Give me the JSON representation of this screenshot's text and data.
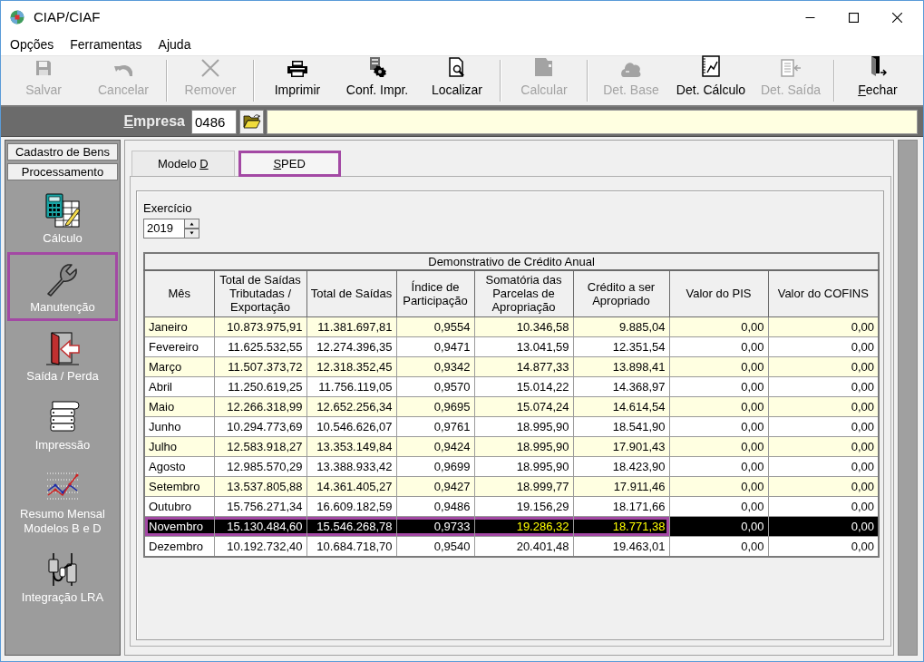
{
  "window": {
    "title": "CIAP/CIAF"
  },
  "menu": [
    "Opções",
    "Ferramentas",
    "Ajuda"
  ],
  "toolbar": {
    "groups": [
      {
        "buttons": [
          {
            "label": "Salvar",
            "kind": "save",
            "disabled": true
          },
          {
            "label": "Cancelar",
            "kind": "cancel",
            "disabled": true
          }
        ]
      },
      {
        "buttons": [
          {
            "label": "Remover",
            "kind": "remove",
            "disabled": true
          }
        ]
      },
      {
        "buttons": [
          {
            "label": "Imprimir",
            "kind": "print",
            "disabled": false
          },
          {
            "label": "Conf. Impr.",
            "kind": "print-setup",
            "disabled": false
          },
          {
            "label": "Localizar",
            "kind": "find",
            "disabled": false
          }
        ]
      },
      {
        "buttons": [
          {
            "label": "Calcular",
            "kind": "calculate",
            "disabled": true
          }
        ]
      },
      {
        "buttons": [
          {
            "label": "Det. Base",
            "kind": "base-detail",
            "disabled": true
          },
          {
            "label": "Det. Cálculo",
            "kind": "calc-detail",
            "disabled": false
          },
          {
            "label": "Det. Saída",
            "kind": "exit-detail",
            "disabled": true
          }
        ]
      },
      {
        "buttons": [
          {
            "label": "Fechar",
            "kind": "close",
            "disabled": false,
            "first_letter_underlined": true
          }
        ]
      }
    ]
  },
  "company": {
    "label": "Empresa",
    "first_letter_underlined": true,
    "code": "0486"
  },
  "sidebar": {
    "sections": [
      {
        "label": "Cadastro de Bens"
      },
      {
        "label": "Processamento",
        "items": [
          {
            "label": "Cálculo",
            "kind": "calculator",
            "highlighted": false
          },
          {
            "label": "Manutenção",
            "kind": "wrench",
            "highlighted": true
          },
          {
            "label": "Saída / Perda",
            "kind": "door",
            "highlighted": false
          },
          {
            "label": "Impressão",
            "kind": "paper",
            "highlighted": false
          },
          {
            "label": "Resumo Mensal Modelos B e D",
            "kind": "chart",
            "highlighted": false
          },
          {
            "label": "Integração LRA",
            "kind": "plugs",
            "highlighted": false
          }
        ]
      }
    ]
  },
  "tabs": [
    {
      "label": "Modelo D",
      "last_letter_underlined": true,
      "selected": false,
      "highlighted": false
    },
    {
      "label": "SPED",
      "first_letter_underlined": true,
      "selected": true,
      "highlighted": true
    }
  ],
  "exercise": {
    "label": "Exercício",
    "value": "2019"
  },
  "table": {
    "title": "Demonstrativo de Crédito Anual",
    "columns": [
      "Mês",
      "Total de Saídas Tributadas / Exportação",
      "Total de Saídas",
      "Índice de Participação",
      "Somatória das Parcelas de Apropriação",
      "Crédito a ser Apropriado",
      "Valor do PIS",
      "Valor do COFINS"
    ],
    "rows": [
      {
        "selected": false,
        "cells": [
          {
            "text": "Janeiro",
            "accent": false,
            "outlined": false
          },
          {
            "text": "10.873.975,91",
            "accent": false,
            "outlined": false
          },
          {
            "text": "11.381.697,81",
            "accent": false,
            "outlined": false
          },
          {
            "text": "0,9554",
            "accent": false,
            "outlined": false
          },
          {
            "text": "10.346,58",
            "accent": false,
            "outlined": false
          },
          {
            "text": "9.885,04",
            "accent": false,
            "outlined": false
          },
          {
            "text": "0,00",
            "accent": false,
            "outlined": false
          },
          {
            "text": "0,00",
            "accent": false,
            "outlined": false
          }
        ]
      },
      {
        "selected": false,
        "cells": [
          {
            "text": "Fevereiro",
            "accent": false,
            "outlined": false
          },
          {
            "text": "11.625.532,55",
            "accent": false,
            "outlined": false
          },
          {
            "text": "12.274.396,35",
            "accent": false,
            "outlined": false
          },
          {
            "text": "0,9471",
            "accent": false,
            "outlined": false
          },
          {
            "text": "13.041,59",
            "accent": false,
            "outlined": false
          },
          {
            "text": "12.351,54",
            "accent": false,
            "outlined": false
          },
          {
            "text": "0,00",
            "accent": false,
            "outlined": false
          },
          {
            "text": "0,00",
            "accent": false,
            "outlined": false
          }
        ]
      },
      {
        "selected": false,
        "cells": [
          {
            "text": "Março",
            "accent": false,
            "outlined": false
          },
          {
            "text": "11.507.373,72",
            "accent": false,
            "outlined": false
          },
          {
            "text": "12.318.352,45",
            "accent": false,
            "outlined": false
          },
          {
            "text": "0,9342",
            "accent": false,
            "outlined": false
          },
          {
            "text": "14.877,33",
            "accent": false,
            "outlined": false
          },
          {
            "text": "13.898,41",
            "accent": false,
            "outlined": false
          },
          {
            "text": "0,00",
            "accent": false,
            "outlined": false
          },
          {
            "text": "0,00",
            "accent": false,
            "outlined": false
          }
        ]
      },
      {
        "selected": false,
        "cells": [
          {
            "text": "Abril",
            "accent": false,
            "outlined": false
          },
          {
            "text": "11.250.619,25",
            "accent": false,
            "outlined": false
          },
          {
            "text": "11.756.119,05",
            "accent": false,
            "outlined": false
          },
          {
            "text": "0,9570",
            "accent": false,
            "outlined": false
          },
          {
            "text": "15.014,22",
            "accent": false,
            "outlined": false
          },
          {
            "text": "14.368,97",
            "accent": false,
            "outlined": false
          },
          {
            "text": "0,00",
            "accent": false,
            "outlined": false
          },
          {
            "text": "0,00",
            "accent": false,
            "outlined": false
          }
        ]
      },
      {
        "selected": false,
        "cells": [
          {
            "text": "Maio",
            "accent": false,
            "outlined": false
          },
          {
            "text": "12.266.318,99",
            "accent": false,
            "outlined": false
          },
          {
            "text": "12.652.256,34",
            "accent": false,
            "outlined": false
          },
          {
            "text": "0,9695",
            "accent": false,
            "outlined": false
          },
          {
            "text": "15.074,24",
            "accent": false,
            "outlined": false
          },
          {
            "text": "14.614,54",
            "accent": false,
            "outlined": false
          },
          {
            "text": "0,00",
            "accent": false,
            "outlined": false
          },
          {
            "text": "0,00",
            "accent": false,
            "outlined": false
          }
        ]
      },
      {
        "selected": false,
        "cells": [
          {
            "text": "Junho",
            "accent": false,
            "outlined": false
          },
          {
            "text": "10.294.773,69",
            "accent": false,
            "outlined": false
          },
          {
            "text": "10.546.626,07",
            "accent": false,
            "outlined": false
          },
          {
            "text": "0,9761",
            "accent": false,
            "outlined": false
          },
          {
            "text": "18.995,90",
            "accent": false,
            "outlined": false
          },
          {
            "text": "18.541,90",
            "accent": false,
            "outlined": false
          },
          {
            "text": "0,00",
            "accent": false,
            "outlined": false
          },
          {
            "text": "0,00",
            "accent": false,
            "outlined": false
          }
        ]
      },
      {
        "selected": false,
        "cells": [
          {
            "text": "Julho",
            "accent": false,
            "outlined": false
          },
          {
            "text": "12.583.918,27",
            "accent": false,
            "outlined": false
          },
          {
            "text": "13.353.149,84",
            "accent": false,
            "outlined": false
          },
          {
            "text": "0,9424",
            "accent": false,
            "outlined": false
          },
          {
            "text": "18.995,90",
            "accent": false,
            "outlined": false
          },
          {
            "text": "17.901,43",
            "accent": false,
            "outlined": false
          },
          {
            "text": "0,00",
            "accent": false,
            "outlined": false
          },
          {
            "text": "0,00",
            "accent": false,
            "outlined": false
          }
        ]
      },
      {
        "selected": false,
        "cells": [
          {
            "text": "Agosto",
            "accent": false,
            "outlined": false
          },
          {
            "text": "12.985.570,29",
            "accent": false,
            "outlined": false
          },
          {
            "text": "13.388.933,42",
            "accent": false,
            "outlined": false
          },
          {
            "text": "0,9699",
            "accent": false,
            "outlined": false
          },
          {
            "text": "18.995,90",
            "accent": false,
            "outlined": false
          },
          {
            "text": "18.423,90",
            "accent": false,
            "outlined": false
          },
          {
            "text": "0,00",
            "accent": false,
            "outlined": false
          },
          {
            "text": "0,00",
            "accent": false,
            "outlined": false
          }
        ]
      },
      {
        "selected": false,
        "cells": [
          {
            "text": "Setembro",
            "accent": false,
            "outlined": false
          },
          {
            "text": "13.537.805,88",
            "accent": false,
            "outlined": false
          },
          {
            "text": "14.361.405,27",
            "accent": false,
            "outlined": false
          },
          {
            "text": "0,9427",
            "accent": false,
            "outlined": false
          },
          {
            "text": "18.999,77",
            "accent": false,
            "outlined": false
          },
          {
            "text": "17.911,46",
            "accent": false,
            "outlined": false
          },
          {
            "text": "0,00",
            "accent": false,
            "outlined": false
          },
          {
            "text": "0,00",
            "accent": false,
            "outlined": false
          }
        ]
      },
      {
        "selected": false,
        "cells": [
          {
            "text": "Outubro",
            "accent": false,
            "outlined": false
          },
          {
            "text": "15.756.271,34",
            "accent": false,
            "outlined": false
          },
          {
            "text": "16.609.182,59",
            "accent": false,
            "outlined": false
          },
          {
            "text": "0,9486",
            "accent": false,
            "outlined": false
          },
          {
            "text": "19.156,29",
            "accent": false,
            "outlined": false
          },
          {
            "text": "18.171,66",
            "accent": false,
            "outlined": false
          },
          {
            "text": "0,00",
            "accent": false,
            "outlined": false
          },
          {
            "text": "0,00",
            "accent": false,
            "outlined": false
          }
        ]
      },
      {
        "selected": true,
        "cells": [
          {
            "text": "Novembro",
            "accent": false,
            "outlined": true
          },
          {
            "text": "15.130.484,60",
            "accent": false,
            "outlined": true
          },
          {
            "text": "15.546.268,78",
            "accent": false,
            "outlined": true
          },
          {
            "text": "0,9733",
            "accent": false,
            "outlined": true
          },
          {
            "text": "19.286,32",
            "accent": true,
            "outlined": true
          },
          {
            "text": "18.771,38",
            "accent": true,
            "outlined": true
          },
          {
            "text": "0,00",
            "accent": false,
            "outlined": false
          },
          {
            "text": "0,00",
            "accent": false,
            "outlined": false
          }
        ]
      },
      {
        "selected": false,
        "cells": [
          {
            "text": "Dezembro",
            "accent": false,
            "outlined": false
          },
          {
            "text": "10.192.732,40",
            "accent": false,
            "outlined": false
          },
          {
            "text": "10.684.718,70",
            "accent": false,
            "outlined": false
          },
          {
            "text": "0,9540",
            "accent": false,
            "outlined": false
          },
          {
            "text": "20.401,48",
            "accent": false,
            "outlined": false
          },
          {
            "text": "19.463,01",
            "accent": false,
            "outlined": false
          },
          {
            "text": "0,00",
            "accent": false,
            "outlined": false
          },
          {
            "text": "0,00",
            "accent": false,
            "outlined": false
          }
        ]
      }
    ]
  }
}
